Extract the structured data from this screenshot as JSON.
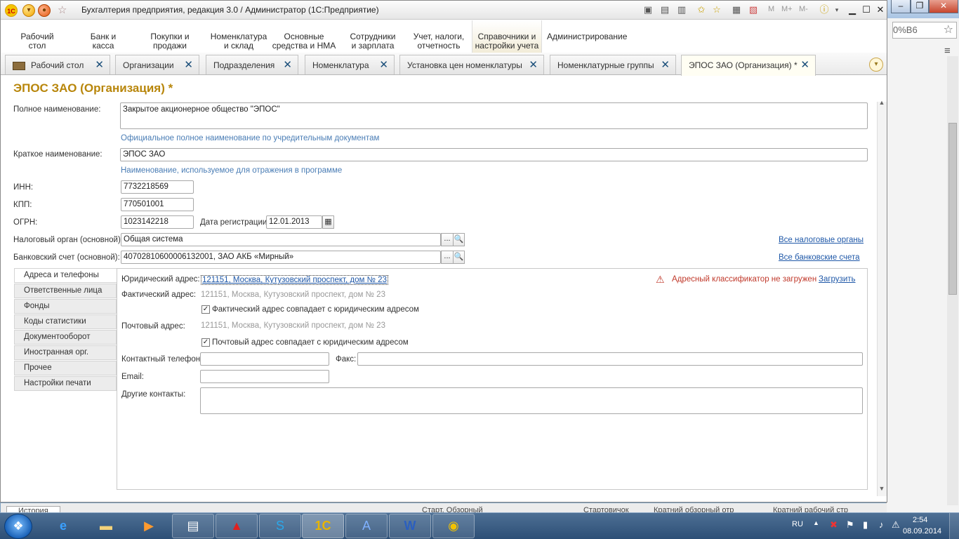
{
  "window": {
    "title": "Бухгалтерия предприятия, редакция 3.0 / Администратор  (1С:Предприятие)",
    "toolbar_texts": [
      "M",
      "M+",
      "M-"
    ]
  },
  "sections": [
    {
      "label": "Рабочий\nстол"
    },
    {
      "label": "Банк и\nкасса"
    },
    {
      "label": "Покупки и\nпродажи"
    },
    {
      "label": "Номенклатура\nи склад"
    },
    {
      "label": "Основные\nсредства и НМА"
    },
    {
      "label": "Сотрудники\nи зарплата"
    },
    {
      "label": "Учет, налоги,\nотчетность"
    },
    {
      "label": "Справочники и\nнастройки учета"
    },
    {
      "label": "Администрирование"
    }
  ],
  "tabs": [
    {
      "label": "Рабочий стол"
    },
    {
      "label": "Организации"
    },
    {
      "label": "Подразделения"
    },
    {
      "label": "Номенклатура"
    },
    {
      "label": "Установка цен номенклатуры"
    },
    {
      "label": "Номенклатурные группы"
    },
    {
      "label": "ЭПОС ЗАО (Организация) *"
    }
  ],
  "form": {
    "title": "ЭПОС ЗАО (Организация) *",
    "full_name_label": "Полное наименование:",
    "full_name_value": "Закрытое акционерное общество \"ЭПОС\"",
    "full_name_hint": "Официальное полное наименование по учредительным документам",
    "short_name_label": "Краткое наименование:",
    "short_name_value": "ЭПОС ЗАО",
    "short_name_hint": "Наименование, используемое для отражения в программе",
    "inn_label": "ИНН:",
    "inn_value": "7732218569",
    "kpp_label": "КПП:",
    "kpp_value": "770501001",
    "ogrn_label": "ОГРН:",
    "ogrn_value": "1023142218",
    "reg_date_label": "Дата регистрации:",
    "reg_date_value": "12.01.2013",
    "tax_label": "Налоговый орган (основной):",
    "tax_value": "Общая система",
    "tax_link": "Все налоговые органы",
    "bank_label": "Банковский счет (основной):",
    "bank_value": "40702810600006132001, ЗАО АКБ «Мирный»",
    "bank_link": "Все банковские счета",
    "dots": "...",
    "search": "🔍"
  },
  "page_tabs": [
    {
      "label": "Адреса и телефоны"
    },
    {
      "label": "Ответственные лица"
    },
    {
      "label": "Фонды"
    },
    {
      "label": "Коды статистики"
    },
    {
      "label": "Документооборот"
    },
    {
      "label": "Иностранная орг."
    },
    {
      "label": "Прочее"
    },
    {
      "label": "Настройки печати"
    }
  ],
  "addresses": {
    "legal_label": "Юридический адрес:",
    "legal_value": "121151, Москва, Кутузовский проспект, дом № 23",
    "warning": "Адресный классификатор не загружен",
    "load_link": "Загрузить",
    "actual_label": "Фактический адрес:",
    "actual_value": "121151, Москва, Кутузовский проспект, дом № 23",
    "actual_checkbox": "Фактический адрес совпадает с юридическим адресом",
    "postal_label": "Почтовый адрес:",
    "postal_value": "121151, Москва, Кутузовский проспект, дом № 23",
    "postal_checkbox": "Почтовый адрес совпадает с юридическим адресом",
    "phone_label": "Контактный телефон:",
    "fax_label": "Факс:",
    "email_label": "Email:",
    "other_label": "Другие контакты:"
  },
  "bottom_strip": [
    "История",
    "Старт. Обзорный",
    "Стартовичок",
    "Кратний обзорный отр",
    "Кратний рабочий стр"
  ],
  "background_window": {
    "address_fragment": "0%B6"
  },
  "taskbar": {
    "language": "RU",
    "time": "2:54",
    "date": "08.09.2014"
  },
  "colors": {
    "title_accent": "#b8860b",
    "hint": "#4a7db5",
    "link": "#1f58a8",
    "warning": "#c0392b"
  }
}
